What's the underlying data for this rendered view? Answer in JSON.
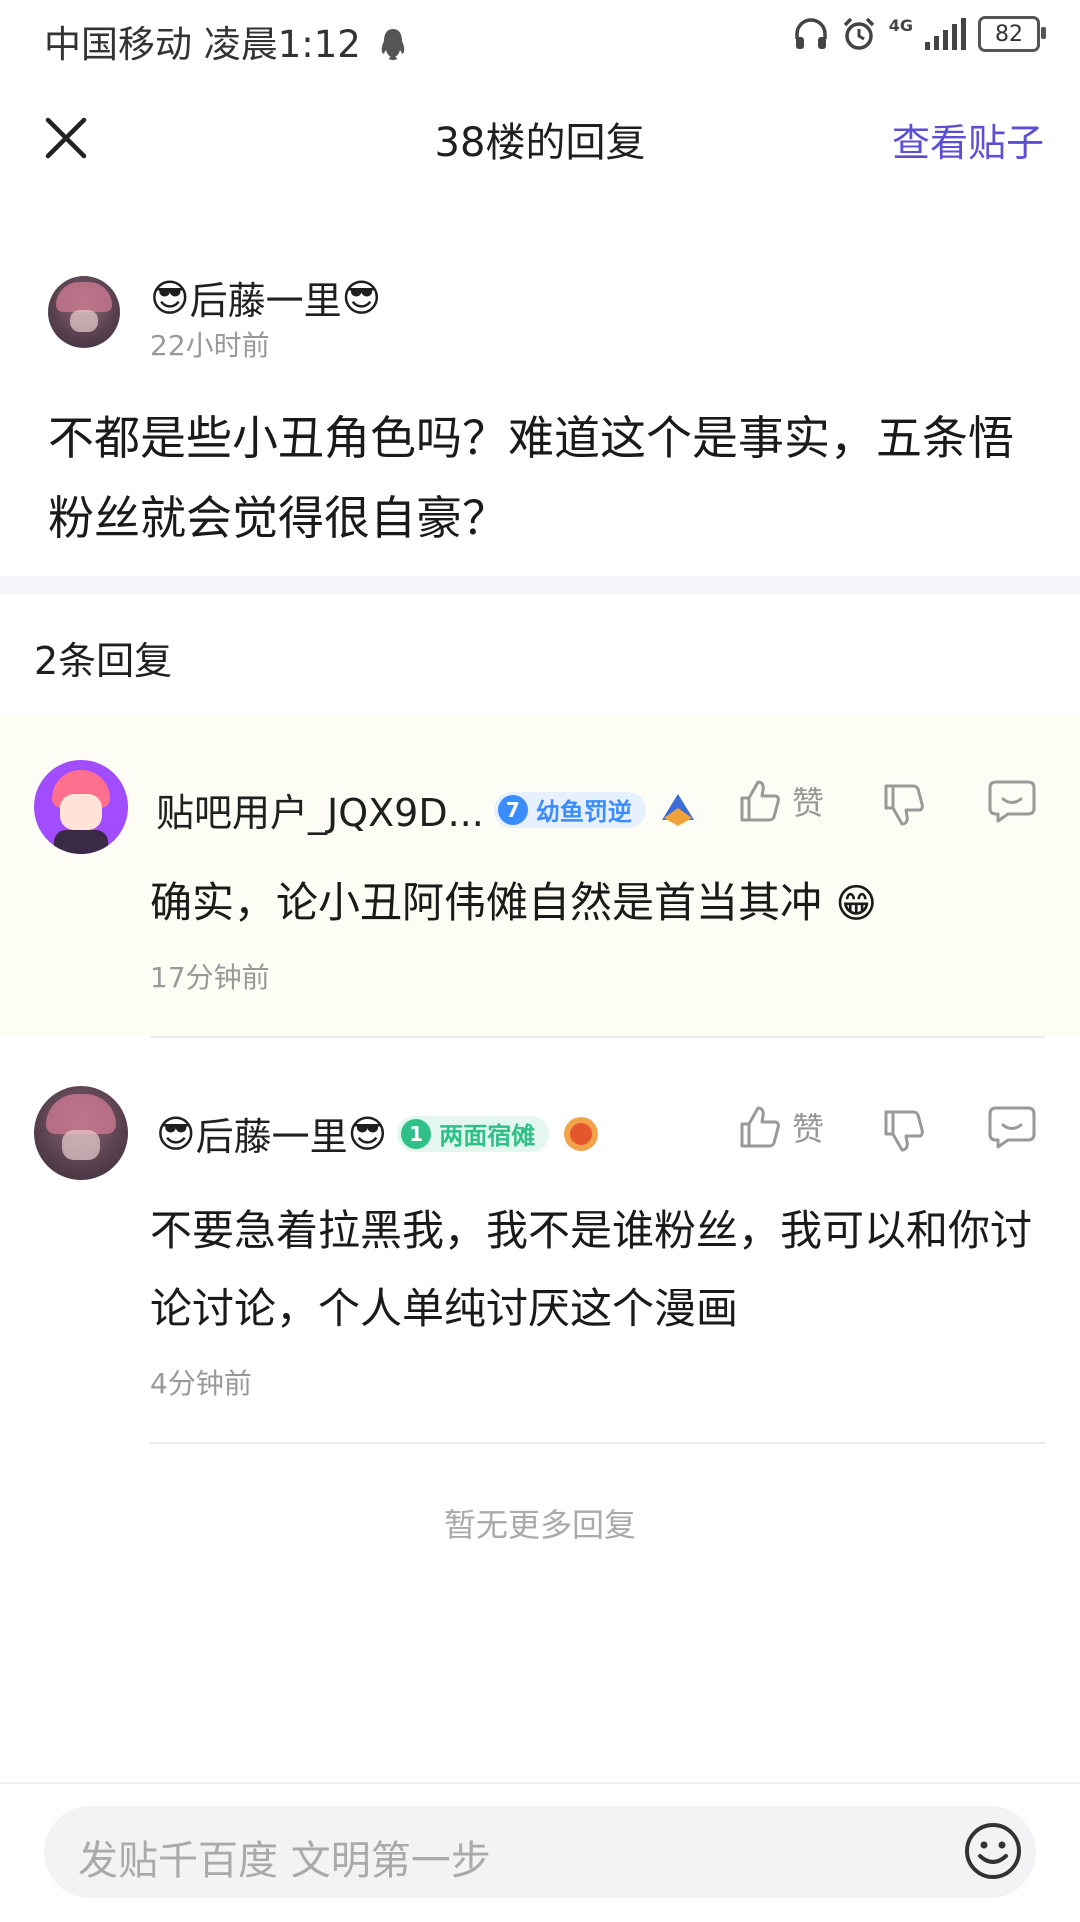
{
  "status_bar": {
    "carrier_time": "中国移动 凌晨1:12",
    "network": "4G",
    "battery": "82"
  },
  "header": {
    "title": "38楼的回复",
    "view_post": "查看贴子"
  },
  "post": {
    "author": "后藤一里",
    "time": "22小时前",
    "body": "不都是些小丑角色吗？难道这个是事实，五条悟粉丝就会觉得很自豪？"
  },
  "replies_header": "2条回复",
  "replies": [
    {
      "author": "贴吧用户_JQX9D...",
      "level": "7",
      "badge": "幼鱼罚逆",
      "like_label": "赞",
      "text": "确实，论小丑阿伟傩自然是首当其冲",
      "time": "17分钟前"
    },
    {
      "author": "后藤一里",
      "level": "1",
      "badge": "两面宿傩",
      "like_label": "赞",
      "text": "不要急着拉黑我，我不是谁粉丝，我可以和你讨论讨论，个人单纯讨厌这个漫画",
      "time": "4分钟前"
    }
  ],
  "no_more": "暂无更多回复",
  "composer": {
    "placeholder": "发贴千百度 文明第一步"
  },
  "colors": {
    "accent": "#5b4fd6",
    "reply_highlight_bg": "#fdfdf5",
    "badge_blue": "#3b8cff",
    "badge_green": "#2fc08a"
  }
}
